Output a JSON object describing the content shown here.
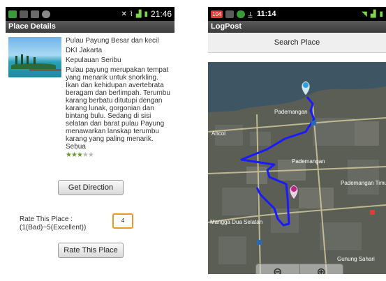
{
  "left": {
    "status_time": "21:46",
    "title": "Place Details",
    "place_name": "Pulau Payung Besar dan kecil",
    "province": "DKI Jakarta",
    "area": "Kepulauan Seribu",
    "description": "Pulau payung merupakan tempat yang menarik untuk snorkling. Ikan dan kehidupan avertebrata beragam dan berlimpah. Terumbu karang berbatu ditutupi dengan karang lunak, gorgonian dan bintang bulu. Sedang di sisi selatan dan barat pulau Payung menawarkan lanskap terumbu karang yang paling menarik. Sebua",
    "rating": {
      "filled": 3,
      "total": 5
    },
    "get_direction_label": "Get Direction",
    "rate_label_line1": "Rate This Place :",
    "rate_label_line2": "(1(Bad)~5(Excellent))",
    "rate_value": "4",
    "rate_button_label": "Rate This Place"
  },
  "right": {
    "status_badge": "104",
    "status_time": "11:14",
    "title": "LogPost",
    "search_label": "Search Place",
    "map_labels": {
      "pademangan": "Pademangan",
      "ancol": "Ancol",
      "pademangan2": "Pademangan",
      "pademangan_timur": "Pademangan Timur",
      "mangga_dua": "Mangga Dua Selatan",
      "gunung": "Gunung Sahari"
    },
    "zoom_out": "⊖",
    "zoom_in": "⊕"
  },
  "colors": {
    "route": "#1a1aff",
    "title_bar": "#4a4a4a",
    "input_border": "#e79a2a"
  }
}
